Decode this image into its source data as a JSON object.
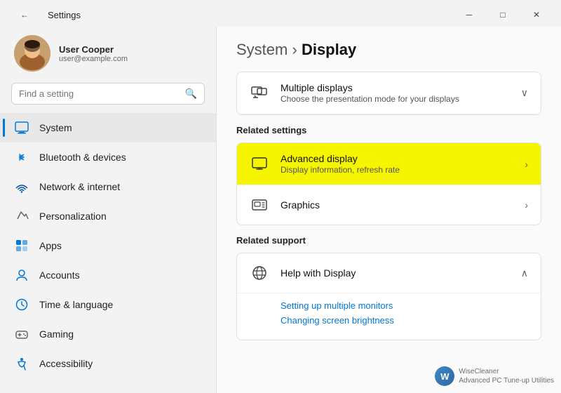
{
  "titlebar": {
    "back_icon": "←",
    "title": "Settings",
    "minimize_label": "─",
    "maximize_label": "□",
    "close_label": "✕"
  },
  "sidebar": {
    "user": {
      "name": "User Cooper",
      "email": "user@example.com"
    },
    "search": {
      "placeholder": "Find a setting"
    },
    "nav_items": [
      {
        "id": "system",
        "label": "System",
        "active": true,
        "icon": "system"
      },
      {
        "id": "bluetooth",
        "label": "Bluetooth & devices",
        "active": false,
        "icon": "bluetooth"
      },
      {
        "id": "network",
        "label": "Network & internet",
        "active": false,
        "icon": "network"
      },
      {
        "id": "personalization",
        "label": "Personalization",
        "active": false,
        "icon": "personalization"
      },
      {
        "id": "apps",
        "label": "Apps",
        "active": false,
        "icon": "apps"
      },
      {
        "id": "accounts",
        "label": "Accounts",
        "active": false,
        "icon": "accounts"
      },
      {
        "id": "time",
        "label": "Time & language",
        "active": false,
        "icon": "time"
      },
      {
        "id": "gaming",
        "label": "Gaming",
        "active": false,
        "icon": "gaming"
      },
      {
        "id": "accessibility",
        "label": "Accessibility",
        "active": false,
        "icon": "accessibility"
      }
    ]
  },
  "content": {
    "breadcrumb_parent": "System",
    "breadcrumb_separator": " › ",
    "breadcrumb_current": "Display",
    "multiple_displays": {
      "title": "Multiple displays",
      "subtitle": "Choose the presentation mode for your displays"
    },
    "related_settings_label": "Related settings",
    "advanced_display": {
      "title": "Advanced display",
      "subtitle": "Display information, refresh rate"
    },
    "graphics": {
      "title": "Graphics"
    },
    "related_support_label": "Related support",
    "help_with_display": {
      "title": "Help with Display"
    },
    "support_links": [
      "Setting up multiple monitors",
      "Changing screen brightness"
    ]
  },
  "wisecleaner": {
    "logo": "W",
    "line1": "WiseCleaner",
    "line2": "Advanced PC Tune-up Utilities"
  }
}
